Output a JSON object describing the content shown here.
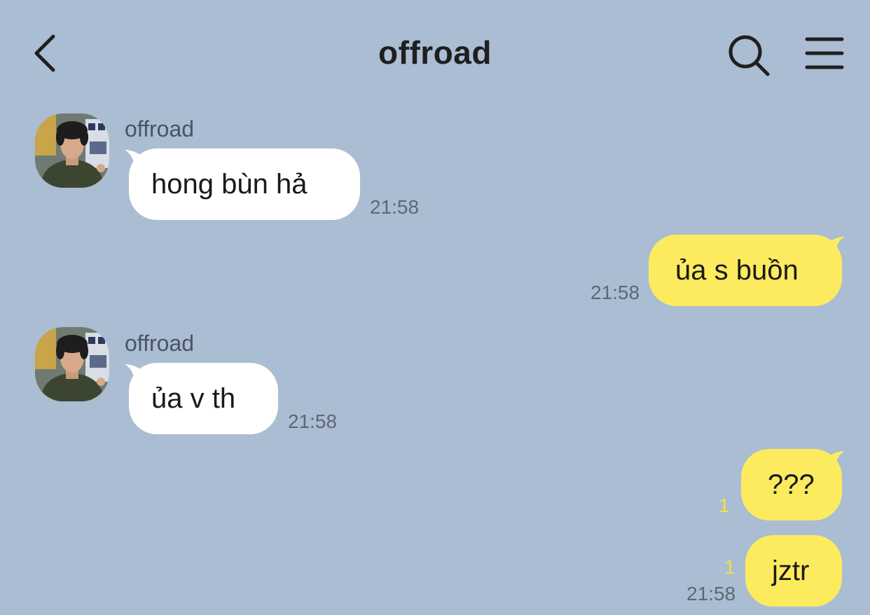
{
  "header": {
    "title": "offroad",
    "back_icon": "chevron-left-icon",
    "search_icon": "search-icon",
    "menu_icon": "hamburger-menu-icon"
  },
  "colors": {
    "background": "#abbdd2",
    "incoming_bubble": "#ffffff",
    "outgoing_bubble": "#fceb5f",
    "unread_count": "#f2e04a"
  },
  "messages": [
    {
      "direction": "incoming",
      "sender": "offroad",
      "text": "hong bùn hả",
      "time": "21:58"
    },
    {
      "direction": "outgoing",
      "text": "ủa s buồn",
      "time": "21:58"
    },
    {
      "direction": "incoming",
      "sender": "offroad",
      "text": "ủa v th",
      "time": "21:58"
    },
    {
      "direction": "outgoing",
      "text": "???",
      "unread": "1"
    },
    {
      "direction": "outgoing",
      "text": "jztr",
      "unread": "1",
      "time": "21:58"
    }
  ]
}
